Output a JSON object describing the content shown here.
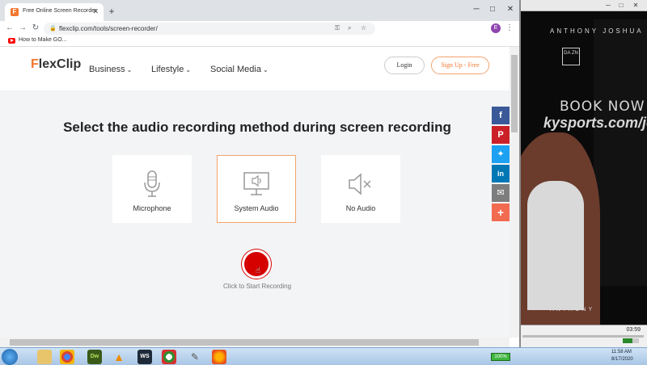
{
  "browser": {
    "tab": {
      "title": "Free Online Screen Recorder",
      "favicon_letter": "F"
    },
    "new_tab": "+",
    "window_controls": {
      "minimize": "─",
      "maximize": "□",
      "close": "✕"
    },
    "nav": {
      "back": "←",
      "forward": "→",
      "reload": "↻"
    },
    "url": "flexclip.com/tools/screen-recorder/",
    "profile_initial": "E",
    "menu": "⋮",
    "bookmark": {
      "label": "How to Make GO..."
    }
  },
  "site": {
    "logo_accent": "F",
    "logo_rest": "lexClip",
    "nav": [
      {
        "label": "Business"
      },
      {
        "label": "Lifestyle"
      },
      {
        "label": "Social Media"
      }
    ],
    "caret": "⌄",
    "login_label": "Login",
    "signup_label": "Sign Up - Free",
    "headline": "Select the audio recording method during screen recording",
    "options": [
      {
        "label": "Microphone",
        "icon": "microphone-icon"
      },
      {
        "label": "System Audio",
        "icon": "monitor-audio-icon",
        "selected": true
      },
      {
        "label": "No Audio",
        "icon": "mute-icon"
      }
    ],
    "record_caption": "Click to Start Recording",
    "social": [
      {
        "icon": "facebook-icon",
        "glyph": "f",
        "color": "#3b5998"
      },
      {
        "icon": "pinterest-icon",
        "glyph": "P",
        "color": "#cb2027"
      },
      {
        "icon": "twitter-icon",
        "glyph": "✦",
        "color": "#1da1f2"
      },
      {
        "icon": "linkedin-icon",
        "glyph": "in",
        "color": "#0077b5"
      },
      {
        "icon": "email-icon",
        "glyph": "✉",
        "color": "#7d7d7d"
      },
      {
        "icon": "share-plus-icon",
        "glyph": "+",
        "color": "#f26a4f"
      }
    ]
  },
  "video": {
    "brand": "ANTHONY JOSHUA",
    "brand_bottom": "ANTHONY",
    "dazn": "DA ZN",
    "book_now": "BOOK NOW",
    "url_text": "kysports.com/josl",
    "time": "03:59"
  },
  "taskbar": {
    "battery": "100%",
    "clock_time": "11:58 AM",
    "clock_date": "8/17/2020"
  }
}
